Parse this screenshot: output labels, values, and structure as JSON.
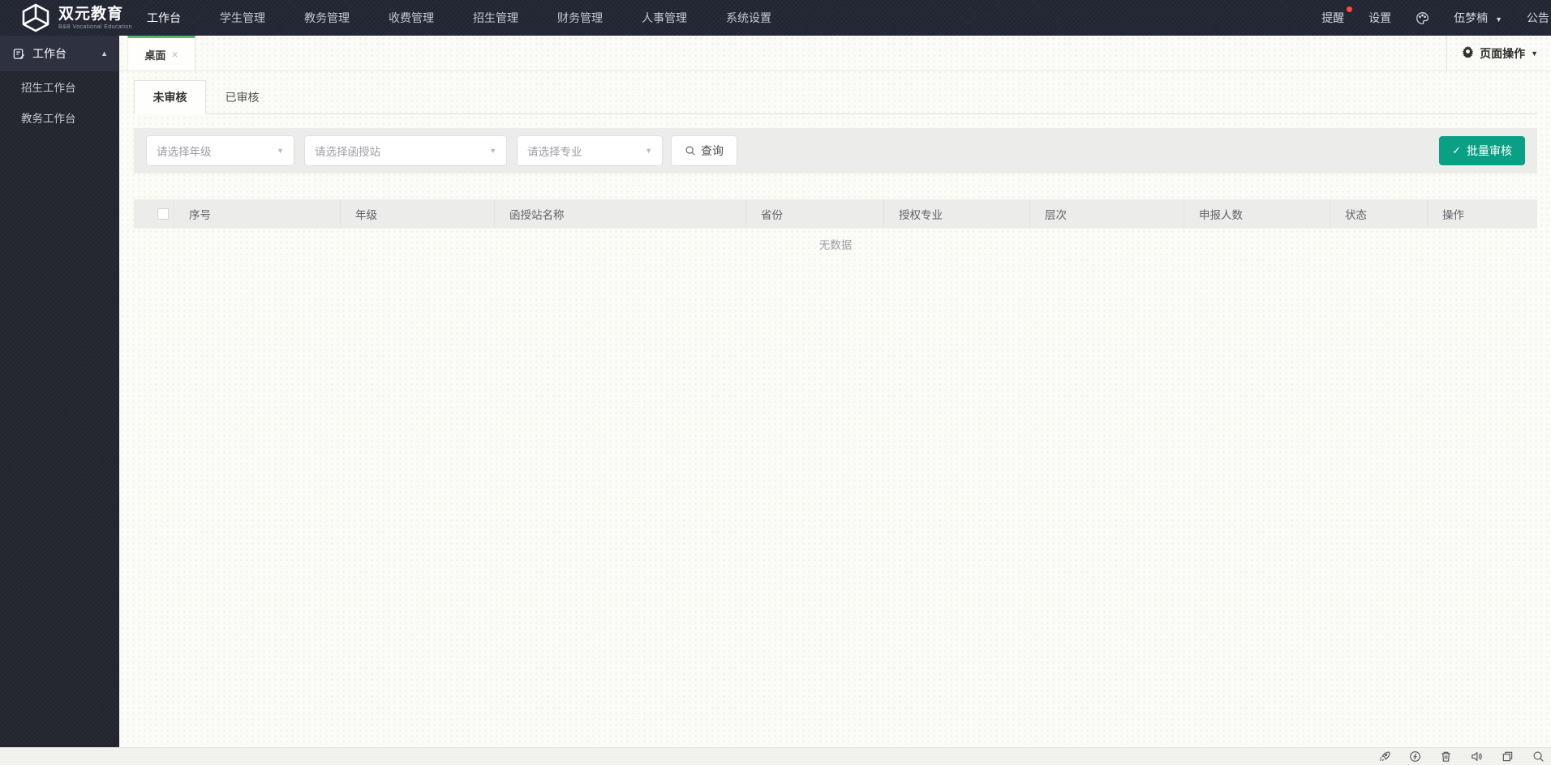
{
  "topbar": {
    "brand": {
      "title": "双元教育",
      "subtitle": "B&B Vocational Education"
    },
    "nav": [
      {
        "label": "工作台",
        "active": true
      },
      {
        "label": "学生管理"
      },
      {
        "label": "教务管理"
      },
      {
        "label": "收费管理"
      },
      {
        "label": "招生管理"
      },
      {
        "label": "财务管理"
      },
      {
        "label": "人事管理"
      },
      {
        "label": "系统设置"
      }
    ],
    "reminder": "提醒",
    "settings": "设置",
    "user": "伍梦楠",
    "notice": "公告"
  },
  "sidebar": {
    "header": "工作台",
    "items": [
      {
        "label": "招生工作台"
      },
      {
        "label": "教务工作台"
      }
    ]
  },
  "tabbar": {
    "active_tab": "桌面",
    "page_actions": "页面操作"
  },
  "subtabs": [
    {
      "label": "未审核",
      "active": true
    },
    {
      "label": "已审核"
    }
  ],
  "filters": {
    "grade_placeholder": "请选择年级",
    "station_placeholder": "请选择函授站",
    "major_placeholder": "请选择专业",
    "search": "查询",
    "batch_review": "批量审核"
  },
  "table": {
    "headers": [
      "序号",
      "年级",
      "函授站名称",
      "省份",
      "授权专业",
      "层次",
      "申报人数",
      "状态",
      "操作"
    ],
    "empty": "无数据",
    "rows": []
  },
  "statusbar": {
    "icons": [
      "rocket",
      "performance",
      "trash",
      "volume",
      "window",
      "magnifier"
    ]
  },
  "colors": {
    "topbar_bg": "#232733",
    "sidebar_bg": "#23262f",
    "tab_accent_green": "#5cb370",
    "primary_teal": "#0aa086",
    "badge_red": "#ff4b33"
  }
}
